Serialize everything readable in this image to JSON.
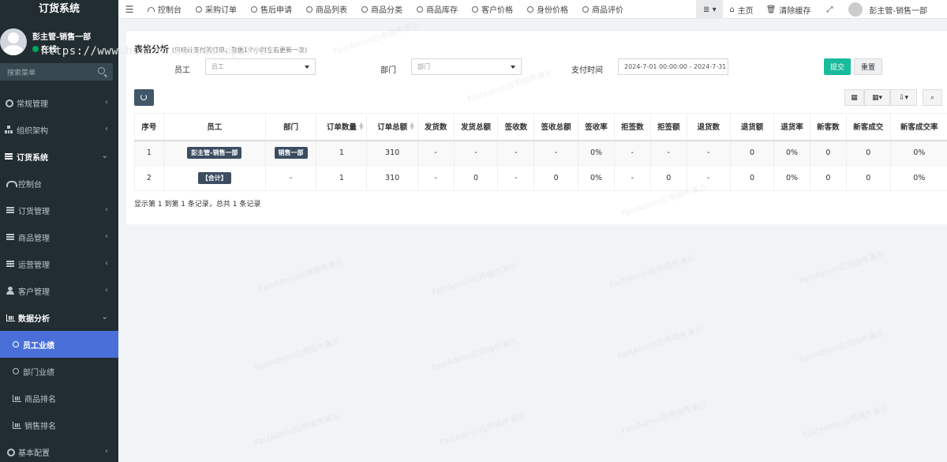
{
  "app": {
    "title": "订货系统"
  },
  "user": {
    "name": "彭主管-销售一部",
    "status": "在线"
  },
  "watermark": {
    "url": "https://www.huzhan.com/ishop27030",
    "text": "FastAdmin应用插件演示"
  },
  "sidebar": {
    "search_placeholder": "搜索菜单",
    "items": [
      {
        "label": "常规管理",
        "icon": "gear-icon",
        "caret": "‹"
      },
      {
        "label": "组织架构",
        "icon": "tree-icon",
        "caret": "‹"
      },
      {
        "label": "订货系统",
        "icon": "bars-icon",
        "caret": "⌄"
      },
      {
        "label": "控制台",
        "icon": "dashboard-icon"
      },
      {
        "label": "订货管理",
        "icon": "bars-icon",
        "caret": "‹"
      },
      {
        "label": "商品管理",
        "icon": "bars-icon",
        "caret": "‹"
      },
      {
        "label": "运营管理",
        "icon": "bars-icon",
        "caret": "‹"
      },
      {
        "label": "客户管理",
        "icon": "users-icon",
        "caret": "‹"
      },
      {
        "label": "数据分析",
        "icon": "chart-icon",
        "caret": "⌄"
      },
      {
        "label": "员工业绩",
        "icon": "circle-icon"
      },
      {
        "label": "部门业绩",
        "icon": "circle-icon"
      },
      {
        "label": "商品排名",
        "icon": "chart-icon"
      },
      {
        "label": "销售排名",
        "icon": "chart-icon"
      },
      {
        "label": "基本配置",
        "icon": "gear-icon",
        "caret": "‹"
      }
    ]
  },
  "topnav": {
    "menu_icon": "☰",
    "tabs": [
      "控制台",
      "采购订单",
      "售后申请",
      "商品列表",
      "商品分类",
      "商品库存",
      "客户价格",
      "身份价格",
      "商品评价"
    ],
    "dropdown": "≣ ▾",
    "home": "主页",
    "clear_cache": "清除缓存",
    "fullscreen": "⤢",
    "user": "彭主管-销售一部"
  },
  "panel": {
    "title": "表格分析",
    "note": "(只统计支付的订单，数据1个小时左右更新一次)",
    "filters": {
      "employee_label": "员工",
      "employee_placeholder": "员工",
      "dept_label": "部门",
      "dept_placeholder": "部门",
      "paytime_label": "支付时间",
      "paytime_value": "2024-7-01 00:00:00 - 2024-7-31"
    },
    "submit": "提交",
    "reset": "重置"
  },
  "table": {
    "headers": [
      "序号",
      "员工",
      "部门",
      "订单数量",
      "订单总额",
      "发货数",
      "发货总额",
      "签收数",
      "签收总额",
      "签收率",
      "拒签数",
      "拒签额",
      "退货数",
      "退货额",
      "退货率",
      "新客数",
      "新客成交",
      "新客成交率"
    ],
    "rows": [
      [
        "1",
        "彭主管-销售一部",
        "销售一部",
        "1",
        "310",
        "-",
        "-",
        "-",
        "-",
        "0%",
        "-",
        "-",
        "-",
        "0",
        "0%",
        "0",
        "0",
        "0%"
      ],
      [
        "2",
        "【合计】",
        "-",
        "1",
        "310",
        "-",
        "0",
        "-",
        "0",
        "0%",
        "-",
        "0",
        "-",
        "0",
        "0%",
        "0",
        "0",
        "0%"
      ]
    ],
    "page_info": "显示第 1 到第 1 条记录，总共 1 条记录"
  }
}
